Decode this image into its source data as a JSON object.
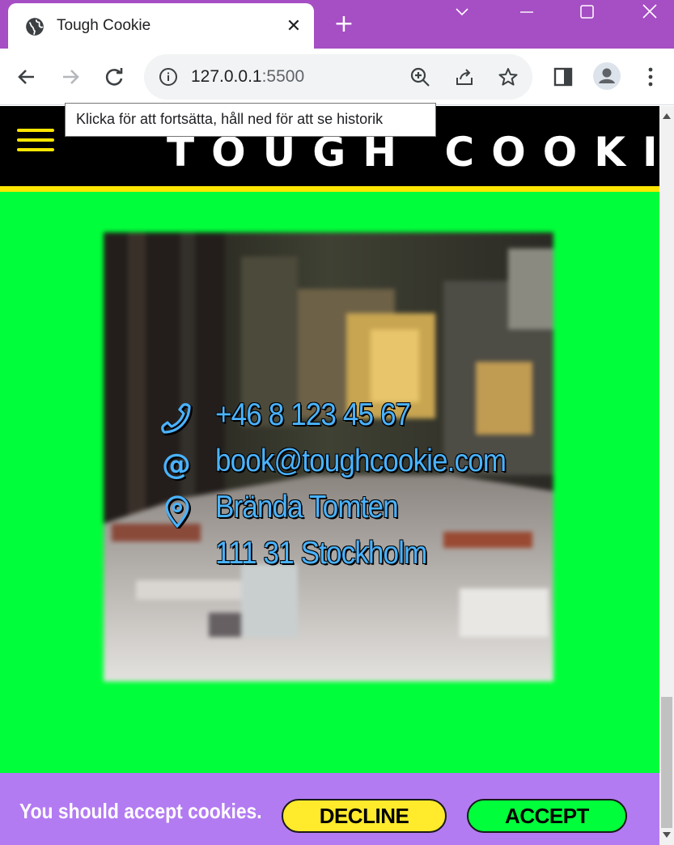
{
  "browser": {
    "tab_title": "Tough Cookie",
    "url_host": "127.0.0.1",
    "url_port": ":5500",
    "tooltip": "Klicka för att fortsätta, håll ned för att se historik",
    "theme_color": "#a64ec4",
    "icons": {
      "tab": "globe-icon",
      "close": "close-icon",
      "new_tab": "plus-icon",
      "back": "arrow-left-icon",
      "forward": "arrow-right-icon",
      "reload": "reload-icon",
      "site_info": "info-icon",
      "zoom": "zoom-in-icon",
      "share": "share-icon",
      "bookmark": "star-icon",
      "side_panel": "side-panel-icon",
      "profile": "profile-icon",
      "menu": "kebab-menu-icon"
    }
  },
  "site": {
    "brand": "TOUGH COOKIE",
    "colors": {
      "background": "#00ff3a",
      "header": "#000000",
      "accent": "#ffe600",
      "contact_text": "#4ab3ff",
      "cookie_bar": "#b37bf2"
    },
    "contact": {
      "phone": "+46 8 123 45 67",
      "email": "book@toughcookie.com",
      "address_line1": "Brända Tomten",
      "address_line2": "111 31 Stockholm"
    },
    "cookie_banner": {
      "message": "You should accept cookies.",
      "decline_label": "DECLINE",
      "accept_label": "ACCEPT"
    }
  }
}
